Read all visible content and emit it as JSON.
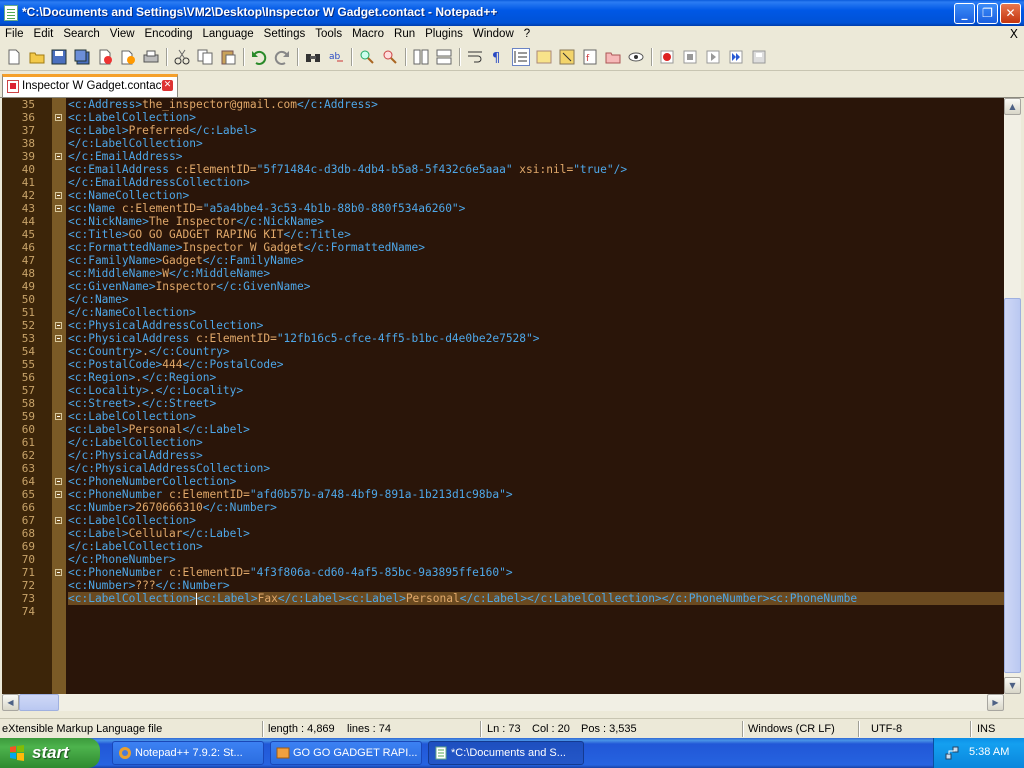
{
  "window": {
    "title": "*C:\\Documents and Settings\\VM2\\Desktop\\Inspector W Gadget.contact - Notepad++",
    "min_label": "_",
    "max_label": "❐",
    "close_label": "✕"
  },
  "menu": {
    "items": [
      "File",
      "Edit",
      "Search",
      "View",
      "Encoding",
      "Language",
      "Settings",
      "Tools",
      "Macro",
      "Run",
      "Plugins",
      "Window",
      "?"
    ],
    "close_glyph": "X"
  },
  "tab": {
    "label": "Inspector W Gadget.contact",
    "close_glyph": "✕"
  },
  "editor": {
    "lines": [
      {
        "n": "35",
        "text": "<c:Address>the_inspector@gmail.com</c:Address>"
      },
      {
        "n": "36",
        "text": "<c:LabelCollection>"
      },
      {
        "n": "37",
        "text": "<c:Label>Preferred</c:Label>"
      },
      {
        "n": "38",
        "text": "</c:LabelCollection>"
      },
      {
        "n": "39",
        "text": "</c:EmailAddress>"
      },
      {
        "n": "40",
        "text": "<c:EmailAddress c:ElementID=\"5f71484c-d3db-4db4-b5a8-5f432c6e5aaa\" xsi:nil=\"true\"/>"
      },
      {
        "n": "41",
        "text": "</c:EmailAddressCollection>"
      },
      {
        "n": "42",
        "text": "<c:NameCollection>"
      },
      {
        "n": "43",
        "text": "<c:Name c:ElementID=\"a5a4bbe4-3c53-4b1b-88b0-880f534a6260\">"
      },
      {
        "n": "44",
        "text": "<c:NickName>The Inspector</c:NickName>"
      },
      {
        "n": "45",
        "text": "<c:Title>GO GO GADGET RAPING KIT</c:Title>"
      },
      {
        "n": "46",
        "text": "<c:FormattedName>Inspector W Gadget</c:FormattedName>"
      },
      {
        "n": "47",
        "text": "<c:FamilyName>Gadget</c:FamilyName>"
      },
      {
        "n": "48",
        "text": "<c:MiddleName>W</c:MiddleName>"
      },
      {
        "n": "49",
        "text": "<c:GivenName>Inspector</c:GivenName>"
      },
      {
        "n": "50",
        "text": "</c:Name>"
      },
      {
        "n": "51",
        "text": "</c:NameCollection>"
      },
      {
        "n": "52",
        "text": "<c:PhysicalAddressCollection>"
      },
      {
        "n": "53",
        "text": "<c:PhysicalAddress c:ElementID=\"12fb16c5-cfce-4ff5-b1bc-d4e0be2e7528\">"
      },
      {
        "n": "54",
        "text": "<c:Country>.</c:Country>"
      },
      {
        "n": "55",
        "text": "<c:PostalCode>444</c:PostalCode>"
      },
      {
        "n": "56",
        "text": "<c:Region>.</c:Region>"
      },
      {
        "n": "57",
        "text": "<c:Locality>.</c:Locality>"
      },
      {
        "n": "58",
        "text": "<c:Street>.</c:Street>"
      },
      {
        "n": "59",
        "text": "<c:LabelCollection>"
      },
      {
        "n": "60",
        "text": "<c:Label>Personal</c:Label>"
      },
      {
        "n": "61",
        "text": "</c:LabelCollection>"
      },
      {
        "n": "62",
        "text": "</c:PhysicalAddress>"
      },
      {
        "n": "63",
        "text": "</c:PhysicalAddressCollection>"
      },
      {
        "n": "64",
        "text": "<c:PhoneNumberCollection>"
      },
      {
        "n": "65",
        "text": "<c:PhoneNumber c:ElementID=\"afd0b57b-a748-4bf9-891a-1b213d1c98ba\">"
      },
      {
        "n": "66",
        "text": "<c:Number>2670666310</c:Number>"
      },
      {
        "n": "67",
        "text": "<c:LabelCollection>"
      },
      {
        "n": "68",
        "text": "<c:Label>Cellular</c:Label>"
      },
      {
        "n": "69",
        "text": "</c:LabelCollection>"
      },
      {
        "n": "70",
        "text": "</c:PhoneNumber>"
      },
      {
        "n": "71",
        "text": "<c:PhoneNumber c:ElementID=\"4f3f806a-cd60-4af5-85bc-9a3895ffe160\">"
      },
      {
        "n": "72",
        "text": "<c:Number>???</c:Number>"
      },
      {
        "n": "73",
        "text_before_caret": "<c:LabelCollection>",
        "text_after_caret": "<c:Label>Fax</c:Label><c:Label>Personal</c:Label></c:LabelCollection></c:PhoneNumber><c:PhoneNumbe"
      },
      {
        "n": "74",
        "text": ""
      }
    ]
  },
  "status": {
    "filetype": "eXtensible Markup Language file",
    "length": "length : 4,869",
    "lines": "lines : 74",
    "ln": "Ln : 73",
    "col": "Col : 20",
    "pos": "Pos : 3,535",
    "eol": "Windows (CR LF)",
    "encoding": "UTF-8",
    "mode": "INS"
  },
  "taskbar": {
    "start_label": "start",
    "tasks": [
      {
        "label": "Notepad++ 7.9.2: St..."
      },
      {
        "label": "GO GO GADGET RAPI..."
      },
      {
        "label": "*C:\\Documents and S..."
      }
    ],
    "clock": "5:38 AM"
  },
  "colors": {
    "editor_bg": "#2a1509",
    "tag": "#4ea7e8",
    "text": "#e0a86a",
    "gutter": "#3c2509"
  }
}
